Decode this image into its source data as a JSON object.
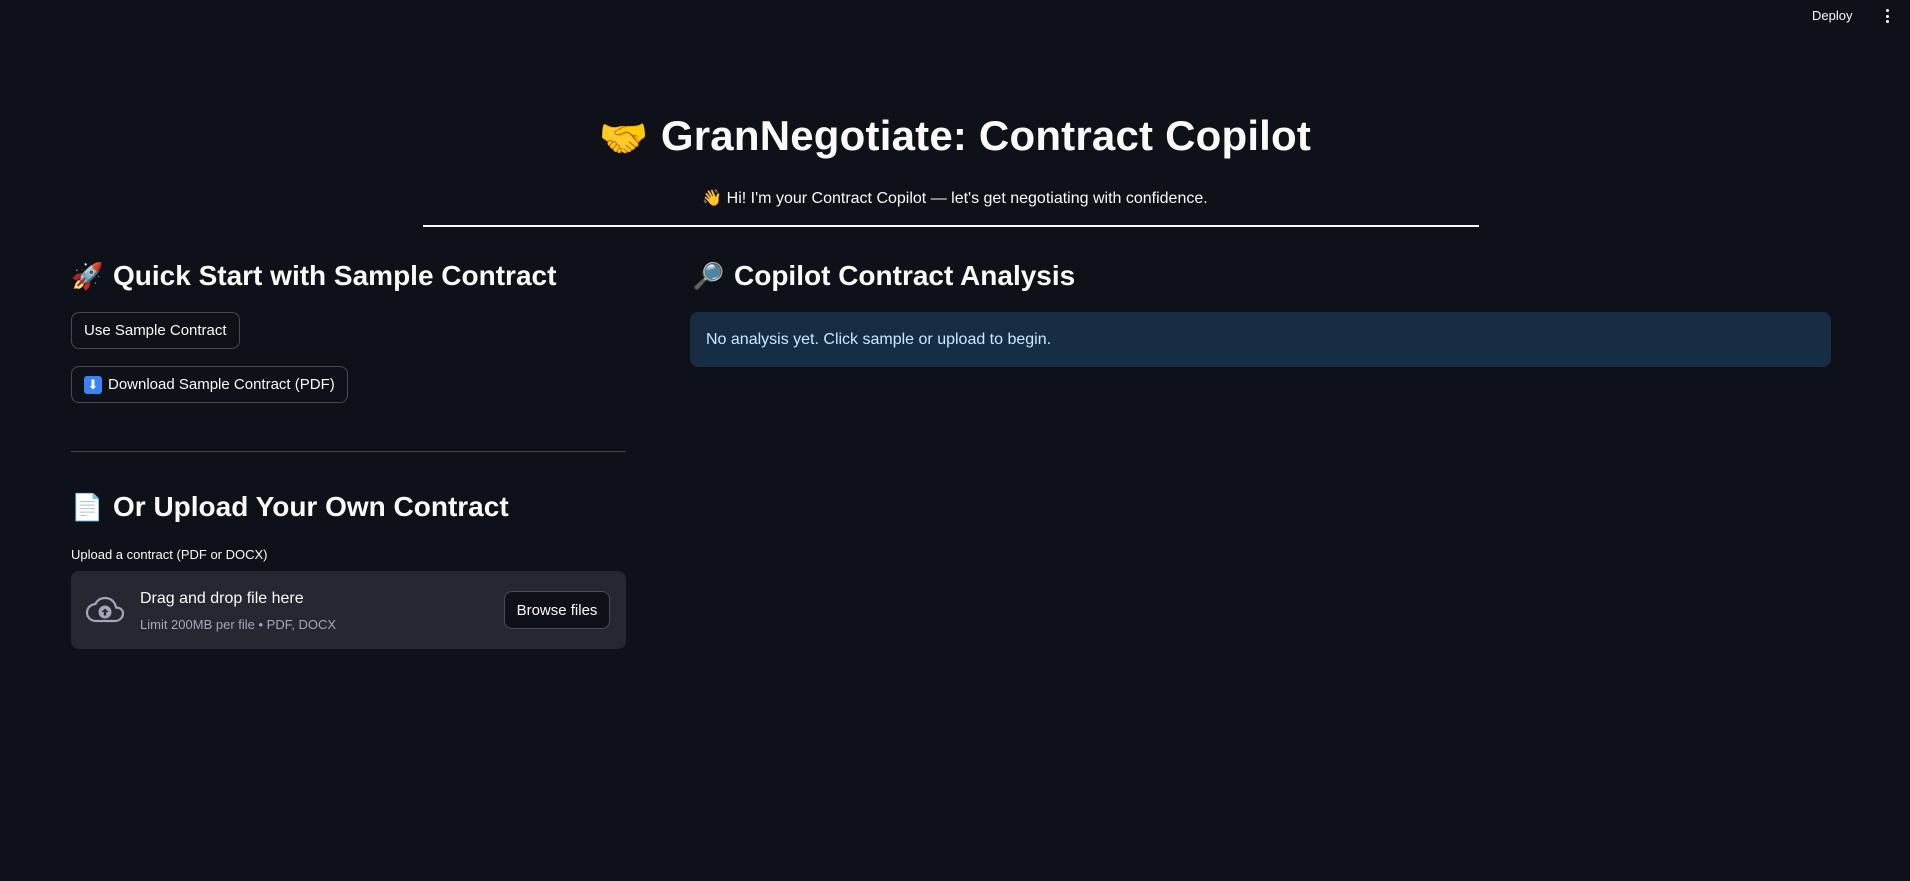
{
  "topbar": {
    "deploy_label": "Deploy",
    "menu_icon": "kebab-menu-icon"
  },
  "header": {
    "title_emoji": "🤝",
    "title": "GranNegotiate: Contract Copilot",
    "subtitle": "👋 Hi! I'm your Contract Copilot — let's get negotiating with confidence."
  },
  "quick_start": {
    "emoji": "🚀",
    "heading": "Quick Start with Sample Contract",
    "use_sample_label": "Use Sample Contract",
    "download_emoji": "⬇",
    "download_label": "Download Sample Contract (PDF)"
  },
  "upload": {
    "emoji": "📄",
    "heading": "Or Upload Your Own Contract",
    "field_label": "Upload a contract (PDF or DOCX)",
    "drop_title": "Drag and drop file here",
    "drop_limit": "Limit 200MB per file • PDF, DOCX",
    "browse_label": "Browse files",
    "icon": "cloud-upload-icon"
  },
  "analysis": {
    "emoji": "🔎",
    "heading": "Copilot Contract Analysis",
    "info_text": "No analysis yet. Click sample or upload to begin."
  },
  "colors": {
    "background": "#0e1117",
    "text": "#fafafa",
    "dropzone_bg": "#262730",
    "info_bg": "#172d43",
    "info_text": "#c7ebff"
  }
}
